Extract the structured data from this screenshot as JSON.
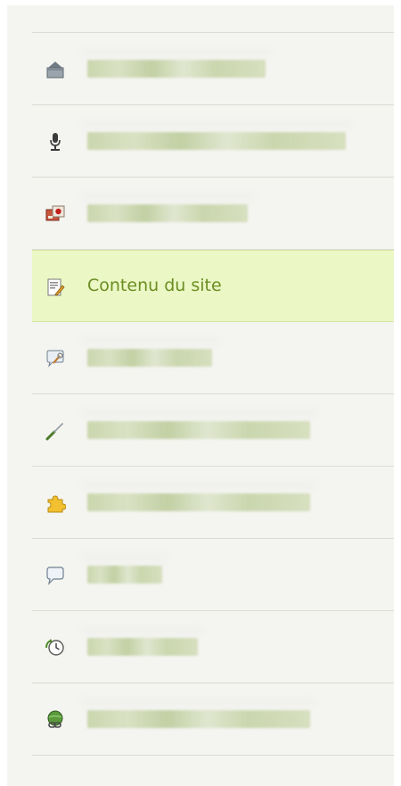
{
  "menu": {
    "items": [
      {
        "id": "home",
        "icon": "home-icon",
        "label": "",
        "blurred": true
      },
      {
        "id": "microphone",
        "icon": "microphone-icon",
        "label": "",
        "blurred": true
      },
      {
        "id": "media",
        "icon": "media-icon",
        "label": "",
        "blurred": true
      },
      {
        "id": "content",
        "icon": "document-edit-icon",
        "label": "Contenu du site",
        "blurred": false,
        "active": true
      },
      {
        "id": "comments-tools",
        "icon": "chat-wrench-icon",
        "label": "",
        "blurred": true
      },
      {
        "id": "tools",
        "icon": "screwdriver-icon",
        "label": "",
        "blurred": true
      },
      {
        "id": "plugins",
        "icon": "puzzle-icon",
        "label": "",
        "blurred": true
      },
      {
        "id": "comments",
        "icon": "speech-bubble-icon",
        "label": "",
        "blurred": true
      },
      {
        "id": "history",
        "icon": "clock-arrow-icon",
        "label": "",
        "blurred": true
      },
      {
        "id": "network",
        "icon": "globe-link-icon",
        "label": "",
        "blurred": true
      }
    ]
  },
  "colors": {
    "active_bg": "#ebf7c4",
    "active_text": "#6b8e23",
    "panel_bg": "#f4f4f0",
    "divider": "#dcdcd6"
  }
}
